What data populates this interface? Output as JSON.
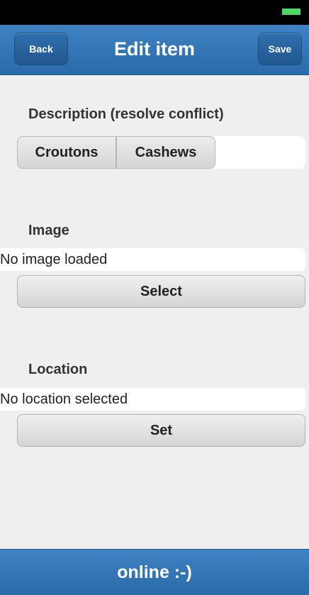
{
  "header": {
    "back_label": "Back",
    "title": "Edit item",
    "save_label": "Save"
  },
  "description": {
    "label": "Description (resolve conflict)",
    "options": [
      "Croutons",
      "Cashews"
    ]
  },
  "image": {
    "label": "Image",
    "value": "No image loaded",
    "button_label": "Select"
  },
  "location": {
    "label": "Location",
    "value": "No location selected",
    "button_label": "Set"
  },
  "footer": {
    "status": "online :-)"
  },
  "colors": {
    "accent": "#2f73b3",
    "battery": "#4cd964"
  }
}
